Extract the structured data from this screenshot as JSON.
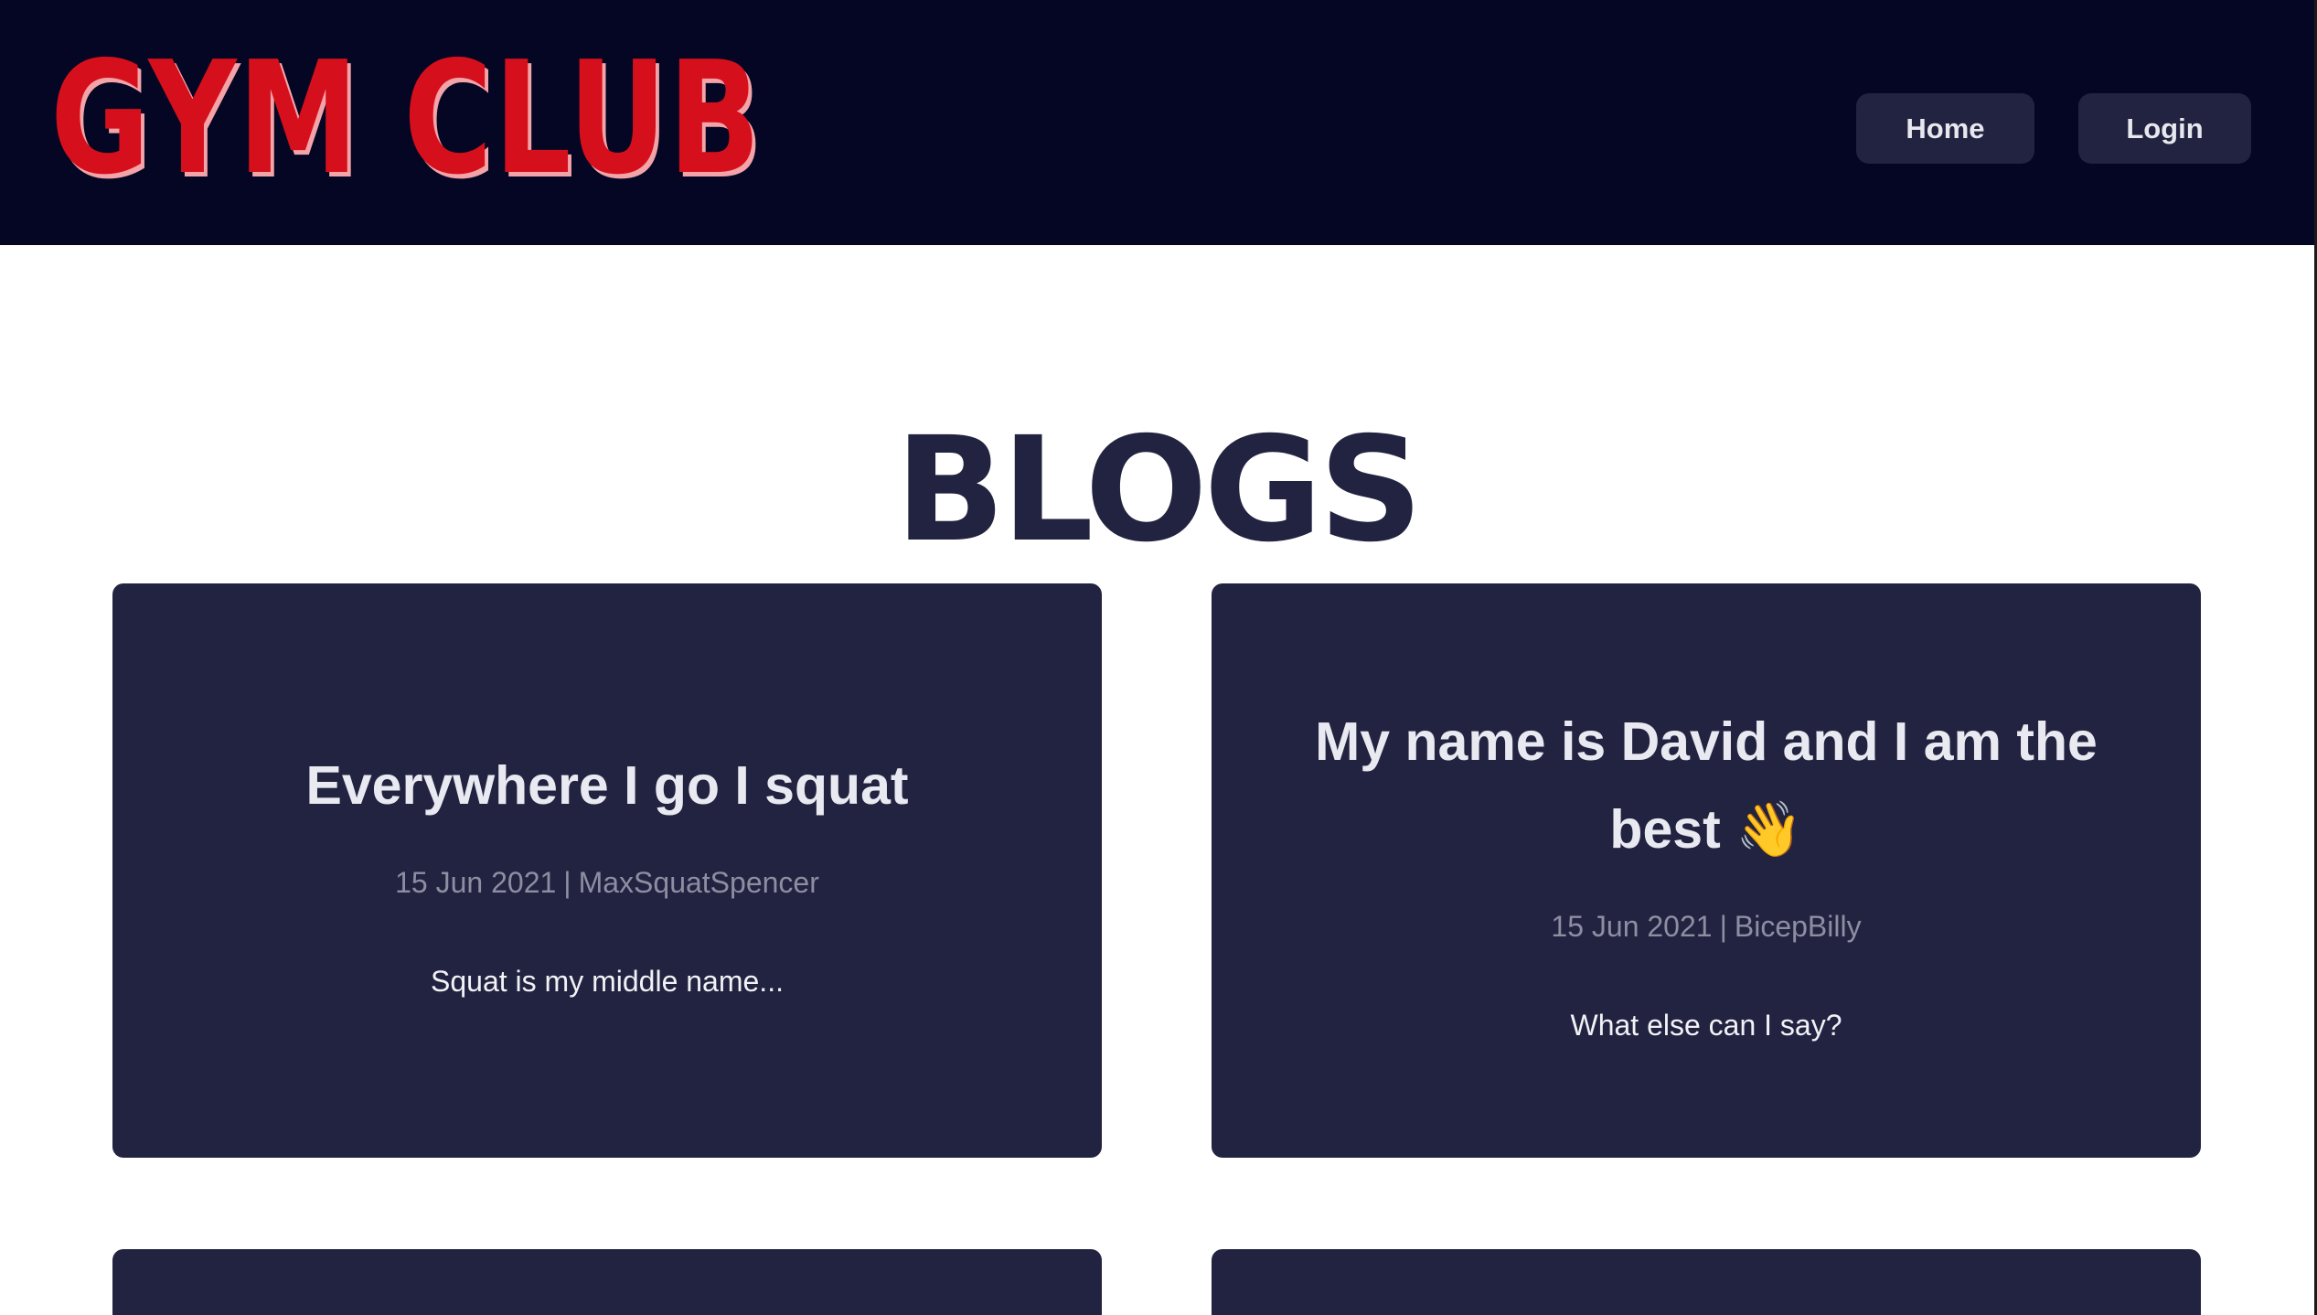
{
  "header": {
    "logo_text": "GYM CLUB",
    "nav": {
      "home_label": "Home",
      "login_label": "Login"
    }
  },
  "main": {
    "title": "BLOGS",
    "posts": [
      {
        "title": "Everywhere I go I squat",
        "date": "15 Jun 2021",
        "author": "MaxSquatSpencer",
        "excerpt": "Squat is my middle name..."
      },
      {
        "title": "My name is David and I am the best 👋",
        "date": "15 Jun 2021",
        "author": "BicepBilly",
        "excerpt": "What else can I say?"
      }
    ],
    "meta_separator": "|"
  },
  "colors": {
    "header_bg": "#050623",
    "logo_red": "#d5101c",
    "logo_shadow": "#f3a4a9",
    "card_bg": "#222340",
    "title_dark": "#222340",
    "meta_gray": "#8d8ea2"
  }
}
